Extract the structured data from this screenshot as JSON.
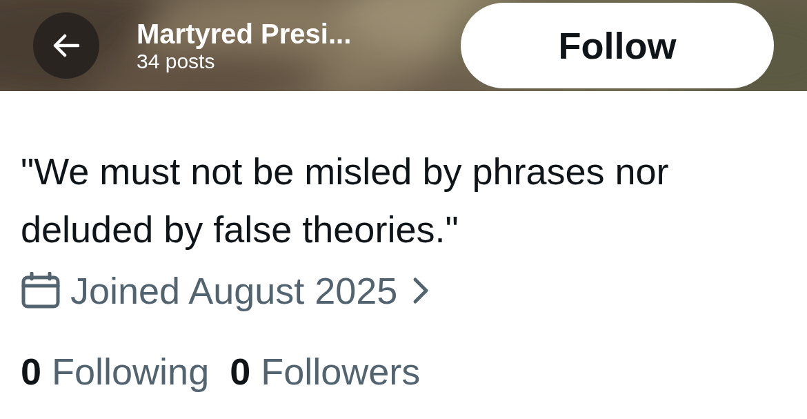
{
  "header": {
    "title": "Martyred Presi...",
    "subtitle": "34 posts",
    "follow_button": "Follow"
  },
  "profile": {
    "bio": "\"We must not be misled by phrases nor deluded by false theories.\"",
    "joined": "Joined August 2025"
  },
  "stats": [
    {
      "count": "0",
      "label": "Following"
    },
    {
      "count": "0",
      "label": "Followers"
    }
  ]
}
